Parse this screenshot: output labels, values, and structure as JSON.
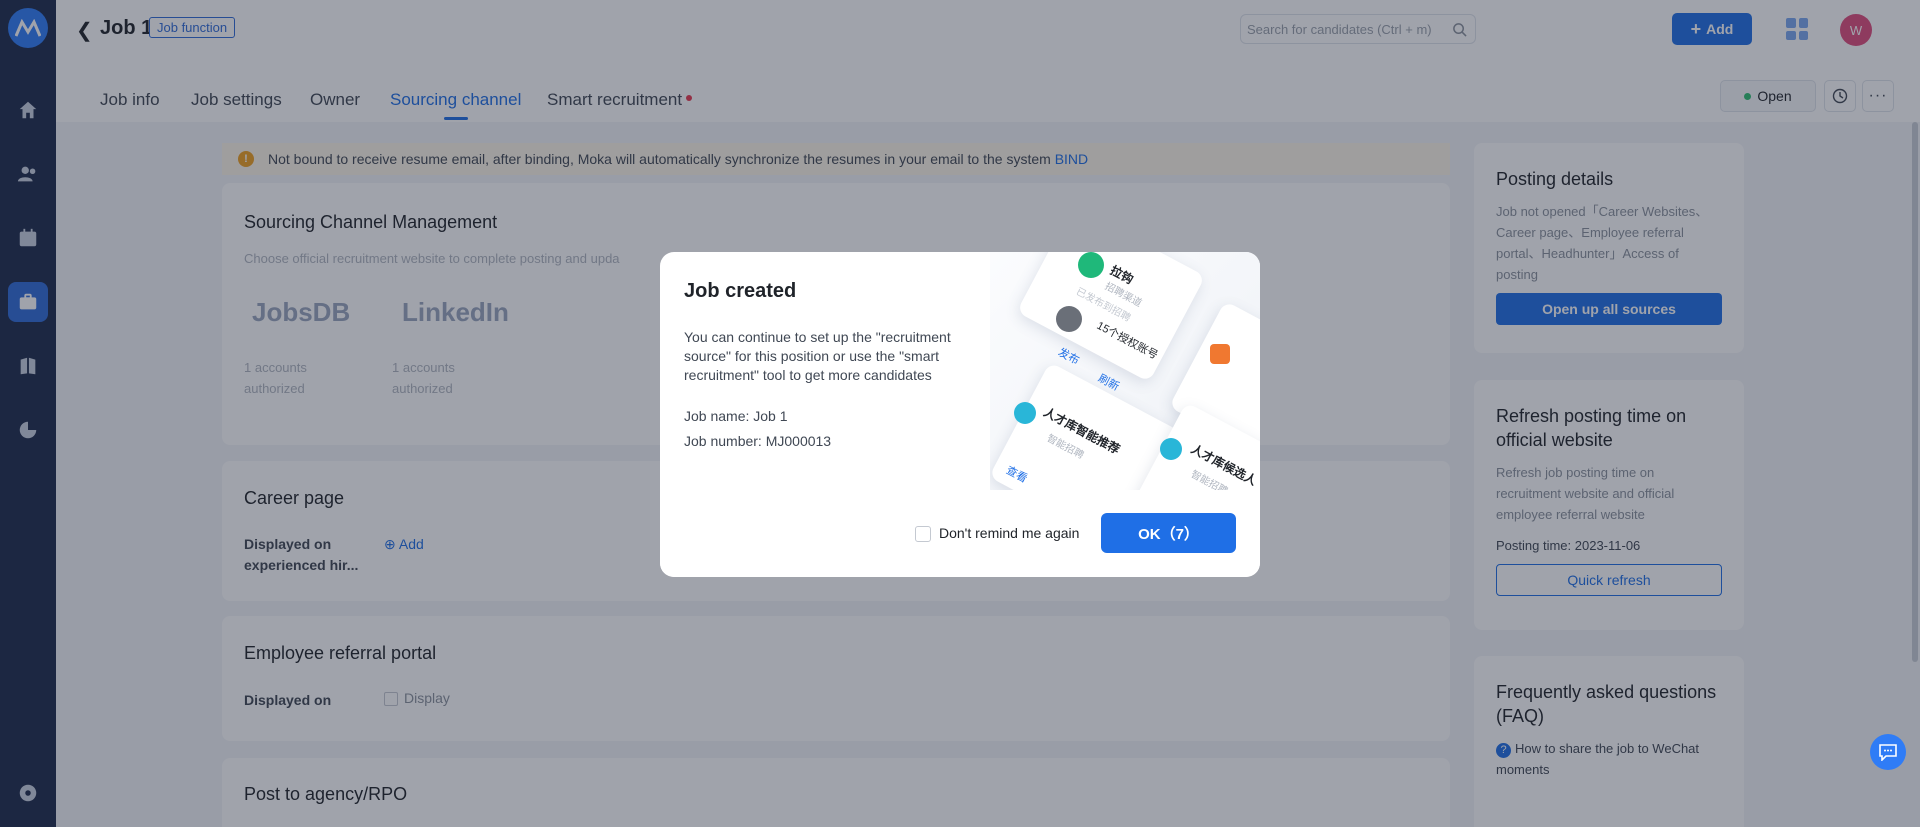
{
  "header": {
    "job_title": "Job 1",
    "function_tag": "Job function",
    "search_placeholder": "Search for candidates (Ctrl + m)",
    "add_label": "Add",
    "avatar_initial": "W"
  },
  "tabs": [
    "Job info",
    "Job settings",
    "Owner",
    "Sourcing channel",
    "Smart recruitment"
  ],
  "active_tab": "Sourcing channel",
  "status": "Open",
  "alert": {
    "text": "Not bound to receive resume email, after binding, Moka will automatically synchronize the resumes in your email to the system",
    "link": "BIND"
  },
  "sourcing": {
    "title": "Sourcing Channel Management",
    "subtitle": "Choose official recruitment website to complete posting and upda",
    "channels": [
      {
        "name": "JobsDB",
        "accounts": "1 accounts",
        "status": "authorized"
      },
      {
        "name": "LinkedIn",
        "accounts": "1 accounts",
        "status": "authorized"
      }
    ]
  },
  "career": {
    "title": "Career page",
    "label": "Displayed on experienced hir...",
    "add": "Add"
  },
  "referral": {
    "title": "Employee referral portal",
    "label": "Displayed on",
    "option": "Display"
  },
  "agency": {
    "title": "Post to agency/RPO"
  },
  "posting": {
    "title": "Posting details",
    "body": "Job not opened「Career Websites、Career page、Employee referral portal、Headhunter」Access of posting",
    "button": "Open up all sources"
  },
  "refresh": {
    "title": "Refresh posting time on official website",
    "body": "Refresh job posting time on recruitment website and official employee referral website",
    "time": "Posting time: 2023-11-06",
    "button": "Quick refresh"
  },
  "faq": {
    "title": "Frequently asked questions (FAQ)",
    "item": "How to share the job to WeChat moments"
  },
  "modal": {
    "title": "Job created",
    "body": "You can continue to set up the \"recruitment source\" for this position or use the \"smart recruitment\" tool to get more candidates",
    "job_name": "Job name: Job 1",
    "job_number": "Job number: MJ000013",
    "checkbox": "Don't remind me again",
    "ok": "OK（7）",
    "art": {
      "c1_title": "拉钩",
      "c1_sub": "招聘渠道",
      "c1_line": "已发布到招聘",
      "c1_acct": "15个授权账号",
      "c1_a": "发布",
      "c1_b": "刷新",
      "c2_title": "人才库智能推荐",
      "c2_sub": "智能招聘",
      "c2_a": "查看",
      "c3_title": "人才库候选人",
      "c3_sub": "智能招聘"
    }
  }
}
